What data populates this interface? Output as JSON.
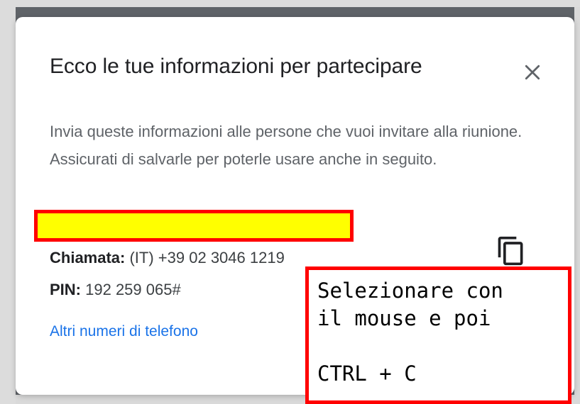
{
  "dialog": {
    "title": "Ecco le tue informazioni per partecipare",
    "description": "Invia queste informazioni alle persone che vuoi invitare alla riunione. Assicurati di salvarle per poterle usare anche in seguito.",
    "call_label": "Chiamata:",
    "call_value": "(IT) +39 02 3046 1219",
    "pin_label": "PIN:",
    "pin_value": "192 259 065#",
    "other_numbers_link": "Altri numeri di telefono"
  },
  "annotation": {
    "line1": "Selezionare con",
    "line2": "il mouse e poi",
    "line3": "",
    "line4": "CTRL + C"
  },
  "colors": {
    "highlight_fill": "#ffff00",
    "highlight_border": "#ff0000",
    "link": "#1a73e8",
    "backdrop": "#5f6368"
  },
  "icons": {
    "close": "close-icon",
    "copy": "copy-icon"
  }
}
